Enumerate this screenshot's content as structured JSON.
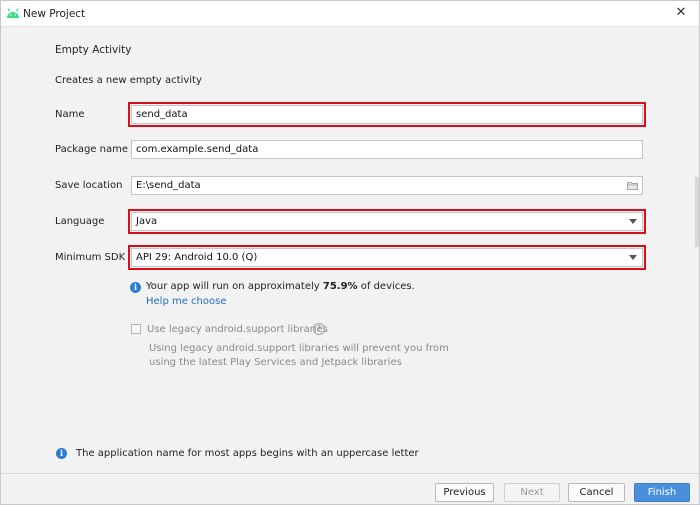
{
  "window": {
    "title": "New Project",
    "icon": "android-icon",
    "close_symbol": "✕"
  },
  "page": {
    "heading": "Empty Activity",
    "description": "Creates a new empty activity"
  },
  "form": {
    "name": {
      "label": "Name",
      "value": "send_data"
    },
    "package_name": {
      "label": "Package name",
      "value": "com.example.send_data"
    },
    "save_location": {
      "label": "Save location",
      "value": "E:\\send_data",
      "icon": "folder-icon"
    },
    "language": {
      "label": "Language",
      "value": "Java"
    },
    "minimum_sdk": {
      "label": "Minimum SDK",
      "value": "API 29: Android 10.0 (Q)"
    }
  },
  "sdk_info": {
    "text_before": "Your app will run on approximately ",
    "percentage": "75.9%",
    "text_after": " of devices.",
    "help_link": "Help me choose"
  },
  "legacy": {
    "checkbox_label": "Use legacy android.support libraries",
    "checked": false,
    "help_symbol": "?",
    "description": "Using legacy android.support libraries will prevent you from using the latest Play Services and Jetpack libraries"
  },
  "notice": {
    "text": "The application name for most apps begins with an uppercase letter"
  },
  "buttons": {
    "previous": "Previous",
    "next": "Next",
    "cancel": "Cancel",
    "finish": "Finish"
  },
  "colors": {
    "highlight": "#d4111a",
    "link": "#1f6cc4",
    "info": "#2b7cd3",
    "primary_button": "#4a8fd9"
  }
}
